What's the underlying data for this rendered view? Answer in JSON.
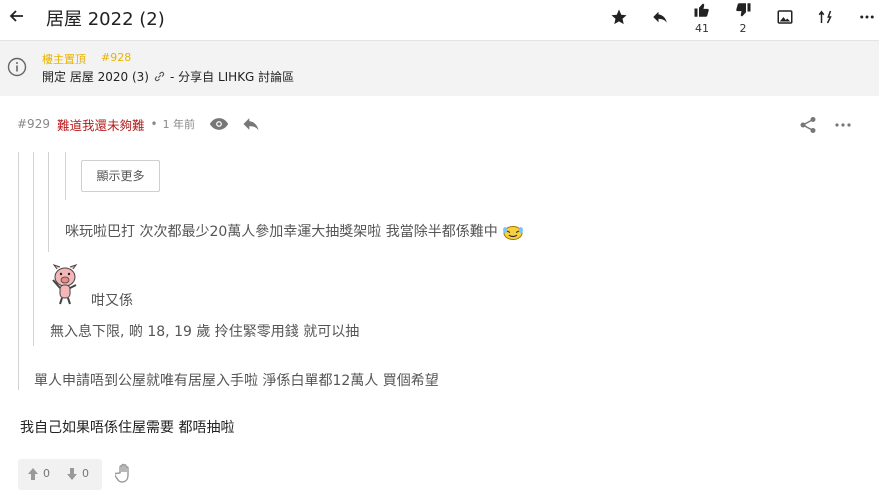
{
  "header": {
    "title": "居屋 2022 (2)",
    "likes": "41",
    "dislikes": "2"
  },
  "pinned": {
    "label": "樓主置頂",
    "post_num": "#928",
    "text_before": "開定 居屋 2020 (3)",
    "text_after": "- 分享自 LIHKG 討論區"
  },
  "post": {
    "number": "#929",
    "author": "難道我還未夠難",
    "dot": "•",
    "time": "1 年前",
    "show_more": "顯示更多",
    "quote3": "咪玩啦巴打 次次都最少20萬人參加幸運大抽獎架啦 我當除半都係難中",
    "quote2_sticker_text": "咁又係",
    "quote2": "無入息下限, 啲 18, 19 歲 拎住緊零用錢 就可以抽",
    "quote1": "單人申請唔到公屋就唯有居屋入手啦 淨係白單都12萬人 買個希望",
    "body": "我自己如果唔係住屋需要 都唔抽啦",
    "upvotes": "0",
    "downvotes": "0"
  },
  "colors": {
    "author": "#b31d1d",
    "pinned_label": "#e8b400",
    "pinned_bg": "#f3f3f3",
    "quote_text": "#555555"
  },
  "icons": [
    "back-arrow-icon",
    "star-icon",
    "reply-icon",
    "thumbs-up-icon",
    "thumbs-down-icon",
    "image-icon",
    "sort-icon",
    "more-icon",
    "info-icon",
    "link-icon",
    "eye-icon",
    "share-icon",
    "upvote-icon",
    "downvote-icon",
    "hand-icon"
  ]
}
